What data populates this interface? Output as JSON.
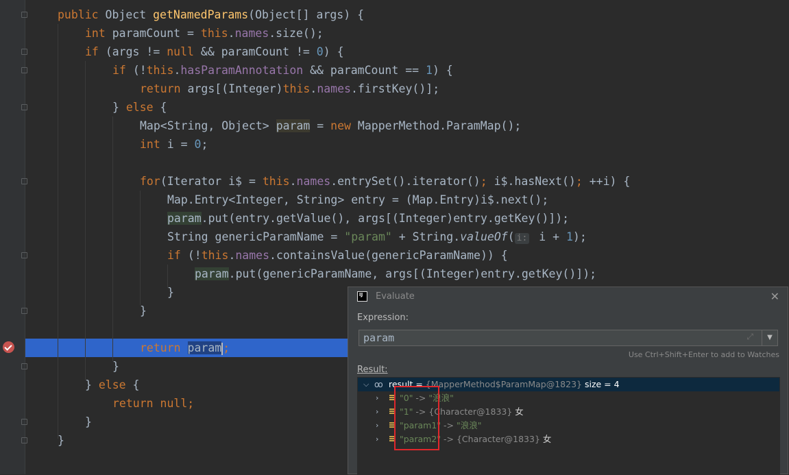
{
  "code": {
    "l1": {
      "kw_public": "public ",
      "type1": "Object ",
      "method": "getNamedParams",
      "args": "(Object[] args) {"
    },
    "l2": {
      "kw": "int ",
      "a": "paramCount = ",
      "this": "this",
      "dot": ".",
      "fld": "names",
      "b": ".size();"
    },
    "l3": {
      "kw": "if ",
      "a": "(args != ",
      "null": "null",
      "b": " && paramCount != ",
      "num": "0",
      "c": ") {"
    },
    "l4": {
      "kw": "if ",
      "a": "(!",
      "this": "this",
      "dot": ".",
      "fld": "hasParamAnnotation",
      "b": " && paramCount == ",
      "num": "1",
      "c": ") {"
    },
    "l5": {
      "kw": "return ",
      "a": "args[(Integer)",
      "this": "this",
      "dot": ".",
      "fld": "names",
      "b": ".firstKey()];"
    },
    "l6": {
      "a": "} ",
      "kw": "else ",
      "b": "{"
    },
    "l7": {
      "a": "Map<String, Object> ",
      "var": "param",
      "b": " = ",
      "kw": "new ",
      "c": "MapperMethod.ParamMap();"
    },
    "l8": {
      "kw": "int ",
      "a": "i = ",
      "num": "0",
      "b": ";"
    },
    "l10": {
      "kw": "for",
      "a": "(Iterator i$ = ",
      "this": "this",
      "dot": ".",
      "fld": "names",
      "b": ".entrySet().iterator()",
      "semi": "; ",
      "c": "i$.hasNext()",
      "semi2": "; ",
      "d": "++i) {"
    },
    "l11": {
      "a": "Map.Entry<Integer, String> entry = (Map.Entry)i$.next();"
    },
    "l12": {
      "var": "param",
      "a": ".put(entry.getValue(), args[(Integer)entry.getKey()]);"
    },
    "l13": {
      "a": "String genericParamName = ",
      "str": "\"param\"",
      "b": " + String.",
      "it": "valueOf",
      "c": "(",
      "hint": "i:",
      "d": " i + ",
      "num": "1",
      "e": ");"
    },
    "l14": {
      "kw": "if ",
      "a": "(!",
      "this": "this",
      "dot": ".",
      "fld": "names",
      "b": ".containsValue(genericParamName)) {"
    },
    "l15": {
      "var": "param",
      "a": ".put(genericParamName, args[(Integer)entry.getKey()]);"
    },
    "l16": {
      "a": "}"
    },
    "l17": {
      "a": "}"
    },
    "l19": {
      "kw": "return ",
      "var": "param",
      "semi": ";"
    },
    "l20": {
      "a": "}"
    },
    "l21": {
      "a": "} ",
      "kw": "else ",
      "b": "{"
    },
    "l22": {
      "kw": "return ",
      "null": "null",
      "semi": ";"
    },
    "l23": {
      "a": "}"
    },
    "l24": {
      "a": "}"
    }
  },
  "evaluate": {
    "title": "Evaluate",
    "expression_label": "Expression:",
    "expression_value": "param",
    "watch_hint": "Use Ctrl+Shift+Enter to add to Watches",
    "result_label": "Result:",
    "root": {
      "name": "result",
      "eq": " = ",
      "obj": "{MapperMethod$ParamMap@1823}",
      "size": "  size = 4"
    },
    "entries": [
      {
        "key": "\"0\"",
        "arrow": " -> ",
        "value": "\"浪浪\"",
        "value_is_str": true,
        "suffix": ""
      },
      {
        "key": "\"1\"",
        "arrow": " -> ",
        "value": "{Character@1833}",
        "value_is_str": false,
        "suffix": " 女"
      },
      {
        "key": "\"param1\"",
        "arrow": " -> ",
        "value": "\"浪浪\"",
        "value_is_str": true,
        "suffix": ""
      },
      {
        "key": "\"param2\"",
        "arrow": " -> ",
        "value": "{Character@1833}",
        "value_is_str": false,
        "suffix": " 女"
      }
    ]
  },
  "icons": [
    "fold-marker-icon",
    "breakpoint-icon",
    "intellij-icon",
    "close-icon",
    "expand-icon",
    "dropdown-arrow-icon",
    "chevron-down-icon",
    "chevron-right-icon",
    "watch-glasses-icon",
    "field-icon"
  ],
  "colors": {
    "keyword": "#cc7832",
    "field": "#9876aa",
    "method": "#ffc66d",
    "string": "#6a8759",
    "number": "#6897bb",
    "execution_line": "#2f65ca",
    "highlight_box": "#e0272b"
  }
}
